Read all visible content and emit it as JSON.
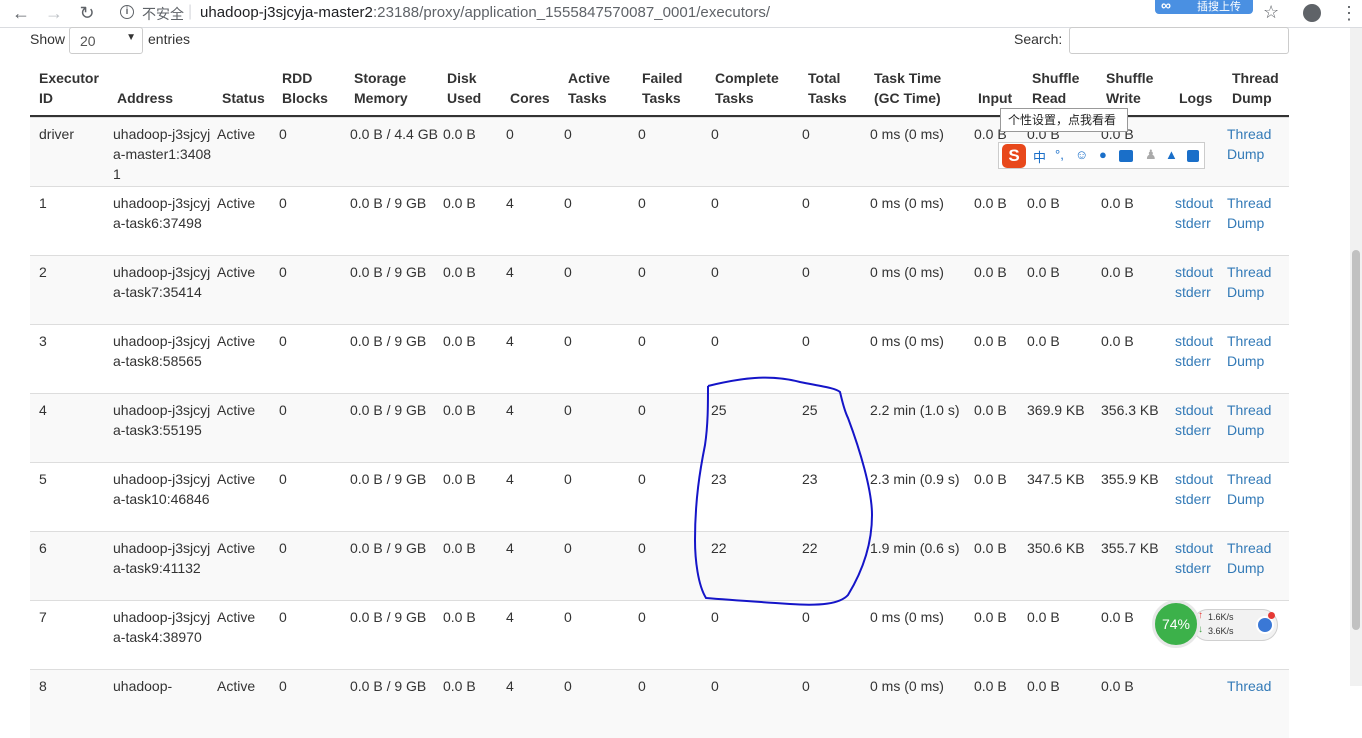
{
  "browser": {
    "insecure_label": "不安全",
    "url_host": "uhadoop-j3sjcyja-master2",
    "url_path": ":23188/proxy/application_1555847570087_0001/executors/",
    "ext_label": "插搜上传"
  },
  "controls": {
    "show_label": "Show",
    "page_size": "20",
    "entries_label": "entries",
    "search_label": "Search:",
    "search_value": ""
  },
  "table": {
    "headers": {
      "executor_id": [
        "Executor",
        "ID"
      ],
      "address": "Address",
      "status": "Status",
      "rdd_blocks": [
        "RDD",
        "Blocks"
      ],
      "storage_memory": [
        "Storage",
        "Memory"
      ],
      "disk_used": [
        "Disk",
        "Used"
      ],
      "cores": "Cores",
      "active_tasks": [
        "Active",
        "Tasks"
      ],
      "failed_tasks": [
        "Failed",
        "Tasks"
      ],
      "complete_tasks": [
        "Complete",
        "Tasks"
      ],
      "total_tasks": [
        "Total",
        "Tasks"
      ],
      "task_time": [
        "Task Time",
        "(GC Time)"
      ],
      "input": "Input",
      "shuffle_read": [
        "Shuffle",
        "Read"
      ],
      "shuffle_write": [
        "Shuffle",
        "Write"
      ],
      "logs": "Logs",
      "thread_dump": [
        "Thread",
        "Dump"
      ]
    },
    "rows": [
      {
        "id": "driver",
        "address": "uhadoop-j3sjcyja-master1:34081",
        "status": "Active",
        "rdd": "0",
        "storage": "0.0 B / 4.4 GB",
        "disk": "0.0 B",
        "cores": "0",
        "active": "0",
        "failed": "0",
        "complete": "0",
        "total": "0",
        "time": "0 ms (0 ms)",
        "input": "0.0 B",
        "sread": "0.0 B",
        "swrite": "0.0 B",
        "stdout": "",
        "stderr": "",
        "thread1": "Thread",
        "thread2": "Dump"
      },
      {
        "id": "1",
        "address": "uhadoop-j3sjcyja-task6:37498",
        "status": "Active",
        "rdd": "0",
        "storage": "0.0 B / 9 GB",
        "disk": "0.0 B",
        "cores": "4",
        "active": "0",
        "failed": "0",
        "complete": "0",
        "total": "0",
        "time": "0 ms (0 ms)",
        "input": "0.0 B",
        "sread": "0.0 B",
        "swrite": "0.0 B",
        "stdout": "stdout",
        "stderr": "stderr",
        "thread1": "Thread",
        "thread2": "Dump"
      },
      {
        "id": "2",
        "address": "uhadoop-j3sjcyja-task7:35414",
        "status": "Active",
        "rdd": "0",
        "storage": "0.0 B / 9 GB",
        "disk": "0.0 B",
        "cores": "4",
        "active": "0",
        "failed": "0",
        "complete": "0",
        "total": "0",
        "time": "0 ms (0 ms)",
        "input": "0.0 B",
        "sread": "0.0 B",
        "swrite": "0.0 B",
        "stdout": "stdout",
        "stderr": "stderr",
        "thread1": "Thread",
        "thread2": "Dump"
      },
      {
        "id": "3",
        "address": "uhadoop-j3sjcyja-task8:58565",
        "status": "Active",
        "rdd": "0",
        "storage": "0.0 B / 9 GB",
        "disk": "0.0 B",
        "cores": "4",
        "active": "0",
        "failed": "0",
        "complete": "0",
        "total": "0",
        "time": "0 ms (0 ms)",
        "input": "0.0 B",
        "sread": "0.0 B",
        "swrite": "0.0 B",
        "stdout": "stdout",
        "stderr": "stderr",
        "thread1": "Thread",
        "thread2": "Dump"
      },
      {
        "id": "4",
        "address": "uhadoop-j3sjcyja-task3:55195",
        "status": "Active",
        "rdd": "0",
        "storage": "0.0 B / 9 GB",
        "disk": "0.0 B",
        "cores": "4",
        "active": "0",
        "failed": "0",
        "complete": "25",
        "total": "25",
        "time": "2.2 min (1.0 s)",
        "input": "0.0 B",
        "sread": "369.9 KB",
        "swrite": "356.3 KB",
        "stdout": "stdout",
        "stderr": "stderr",
        "thread1": "Thread",
        "thread2": "Dump"
      },
      {
        "id": "5",
        "address": "uhadoop-j3sjcyja-task10:46846",
        "status": "Active",
        "rdd": "0",
        "storage": "0.0 B / 9 GB",
        "disk": "0.0 B",
        "cores": "4",
        "active": "0",
        "failed": "0",
        "complete": "23",
        "total": "23",
        "time": "2.3 min (0.9 s)",
        "input": "0.0 B",
        "sread": "347.5 KB",
        "swrite": "355.9 KB",
        "stdout": "stdout",
        "stderr": "stderr",
        "thread1": "Thread",
        "thread2": "Dump"
      },
      {
        "id": "6",
        "address": "uhadoop-j3sjcyja-task9:41132",
        "status": "Active",
        "rdd": "0",
        "storage": "0.0 B / 9 GB",
        "disk": "0.0 B",
        "cores": "4",
        "active": "0",
        "failed": "0",
        "complete": "22",
        "total": "22",
        "time": "1.9 min (0.6 s)",
        "input": "0.0 B",
        "sread": "350.6 KB",
        "swrite": "355.7 KB",
        "stdout": "stdout",
        "stderr": "stderr",
        "thread1": "Thread",
        "thread2": "Dump"
      },
      {
        "id": "7",
        "address": "uhadoop-j3sjcyja-task4:38970",
        "status": "Active",
        "rdd": "0",
        "storage": "0.0 B / 9 GB",
        "disk": "0.0 B",
        "cores": "4",
        "active": "0",
        "failed": "0",
        "complete": "0",
        "total": "0",
        "time": "0 ms (0 ms)",
        "input": "0.0 B",
        "sread": "0.0 B",
        "swrite": "0.0 B",
        "stdout": "",
        "stderr": "",
        "thread1": "",
        "thread2": ""
      },
      {
        "id": "8",
        "address": "uhadoop-",
        "status": "Active",
        "rdd": "0",
        "storage": "0.0 B / 9 GB",
        "disk": "0.0 B",
        "cores": "4",
        "active": "0",
        "failed": "0",
        "complete": "0",
        "total": "0",
        "time": "0 ms (0 ms)",
        "input": "0.0 B",
        "sread": "0.0 B",
        "swrite": "0.0 B",
        "stdout": "",
        "stderr": "",
        "thread1": "Thread",
        "thread2": ""
      }
    ]
  },
  "ime": {
    "tooltip": "个性设置，点我看看",
    "logo": "S",
    "zh": "中"
  },
  "net_monitor": {
    "percent": "74%",
    "up_speed": "1.6K/s",
    "down_speed": "3.6K/s"
  },
  "annotation": {
    "color": "#1515c8"
  }
}
